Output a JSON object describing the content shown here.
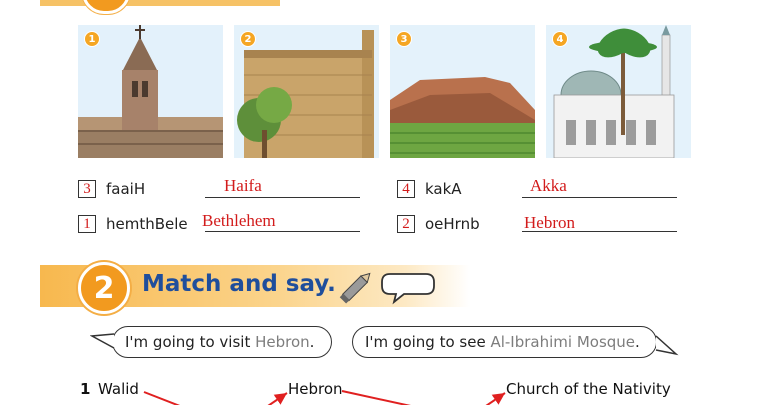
{
  "pictures": [
    {
      "number": "1"
    },
    {
      "number": "2"
    },
    {
      "number": "3"
    },
    {
      "number": "4"
    }
  ],
  "exercise1": {
    "rows": [
      {
        "box": "3",
        "scrambled": "faaiH",
        "answer": "Haifa"
      },
      {
        "box": "4",
        "scrambled": "kakA",
        "answer": "Akka"
      },
      {
        "box": "1",
        "scrambled": "hemthBele",
        "answer": "Bethlehem"
      },
      {
        "box": "2",
        "scrambled": "oeHrnb",
        "answer": "Hebron"
      }
    ]
  },
  "exercise2": {
    "number": "2",
    "title": "Match and say.",
    "bubble1": {
      "text": "I'm going to visit ",
      "place": "Hebron",
      "end": "."
    },
    "bubble2": {
      "text": "I'm going to see ",
      "place": "Al-Ibrahimi Mosque",
      "end": "."
    },
    "row1": {
      "num": "1",
      "name": "Walid",
      "city": "Hebron",
      "place": "Church of the Nativity"
    }
  },
  "colors": {
    "accent": "#f29a1f",
    "title": "#1f4e9c",
    "answer": "#d21b1b"
  }
}
